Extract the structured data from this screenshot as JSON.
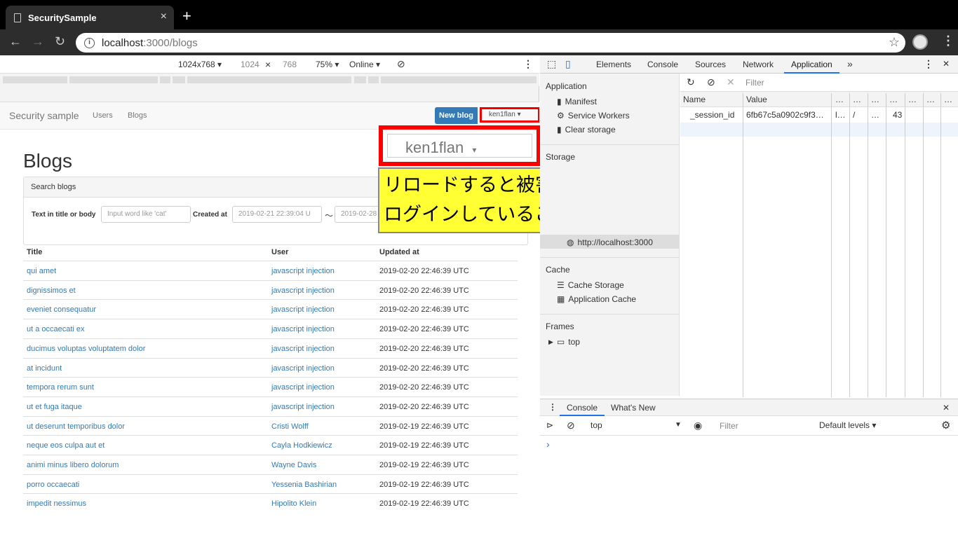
{
  "browser": {
    "tab_title": "SecuritySample",
    "tab_close": "×",
    "new_tab": "+",
    "url_host": "localhost",
    "url_path": ":3000/blogs"
  },
  "device_toolbar": {
    "preset": "1024x768 ▾",
    "width": "1024",
    "times": "×",
    "height": "768",
    "zoom": "75% ▾",
    "network": "Online ▾"
  },
  "app": {
    "brand": "Security sample",
    "nav": [
      "Users",
      "Blogs"
    ],
    "new_blog": "New blog",
    "user_menu": "ken1flan ▾",
    "page_title": "Blogs",
    "search": {
      "header": "Search blogs",
      "text_label": "Text in title or body",
      "text_placeholder": "Input word like 'cat'",
      "created_label": "Created at",
      "created_from": "2019-02-21 22:39:04 U",
      "tilde": "〜",
      "created_to": "2019-02-28"
    },
    "table": {
      "headers": [
        "Title",
        "User",
        "Updated at"
      ],
      "rows": [
        {
          "title": "qui amet",
          "user": "javascript injection",
          "updated": "2019-02-20 22:46:39 UTC"
        },
        {
          "title": "dignissimos et",
          "user": "javascript injection",
          "updated": "2019-02-20 22:46:39 UTC"
        },
        {
          "title": "eveniet consequatur",
          "user": "javascript injection",
          "updated": "2019-02-20 22:46:39 UTC"
        },
        {
          "title": "ut a occaecati ex",
          "user": "javascript injection",
          "updated": "2019-02-20 22:46:39 UTC"
        },
        {
          "title": "ducimus voluptas voluptatem dolor",
          "user": "javascript injection",
          "updated": "2019-02-20 22:46:39 UTC"
        },
        {
          "title": "at incidunt",
          "user": "javascript injection",
          "updated": "2019-02-20 22:46:39 UTC"
        },
        {
          "title": "tempora rerum sunt",
          "user": "javascript injection",
          "updated": "2019-02-20 22:46:39 UTC"
        },
        {
          "title": "ut et fuga itaque",
          "user": "javascript injection",
          "updated": "2019-02-20 22:46:39 UTC"
        },
        {
          "title": "ut deserunt temporibus dolor",
          "user": "Cristi Wolff",
          "updated": "2019-02-19 22:46:39 UTC"
        },
        {
          "title": "neque eos culpa aut et",
          "user": "Cayla Hodkiewicz",
          "updated": "2019-02-19 22:46:39 UTC"
        },
        {
          "title": "animi minus libero dolorum",
          "user": "Wayne Davis",
          "updated": "2019-02-19 22:46:39 UTC"
        },
        {
          "title": "porro occaecati",
          "user": "Yessenia Bashirian",
          "updated": "2019-02-19 22:46:39 UTC"
        },
        {
          "title": "impedit nessimus",
          "user": "Hipolito Klein",
          "updated": "2019-02-19 22:46:39 UTC"
        }
      ]
    }
  },
  "callout": {
    "zoom_user": "ken1flan",
    "zoom_caret": "▾",
    "note_line1": "リロードすると被害者のアカウントで",
    "note_line2": "ログインしていることになっています。"
  },
  "devtools": {
    "tabs": [
      "Elements",
      "Console",
      "Sources",
      "Network",
      "Application"
    ],
    "more": "»",
    "close": "✕",
    "sidebar": {
      "application": "Application",
      "manifest": "Manifest",
      "service_workers": "Service Workers",
      "clear_storage": "Clear storage",
      "storage": "Storage",
      "cookie_origin": "http://localhost:3000",
      "cache": "Cache",
      "cache_storage": "Cache Storage",
      "application_cache": "Application Cache",
      "frames": "Frames",
      "frame_top": "top"
    },
    "grid": {
      "filter_placeholder": "Filter",
      "headers": [
        "Name",
        "Value",
        "…",
        "…",
        "…",
        "…",
        "…",
        "…",
        "…"
      ],
      "row": [
        "_session_id",
        "6fb67c5a0902c9f3…",
        "l…",
        "/",
        "…",
        "43"
      ]
    },
    "console": {
      "tabs": [
        "Console",
        "What's New"
      ],
      "context": "top",
      "context_caret": "▼",
      "filter_placeholder": "Filter",
      "levels": "Default levels ▾",
      "prompt": "›"
    }
  }
}
